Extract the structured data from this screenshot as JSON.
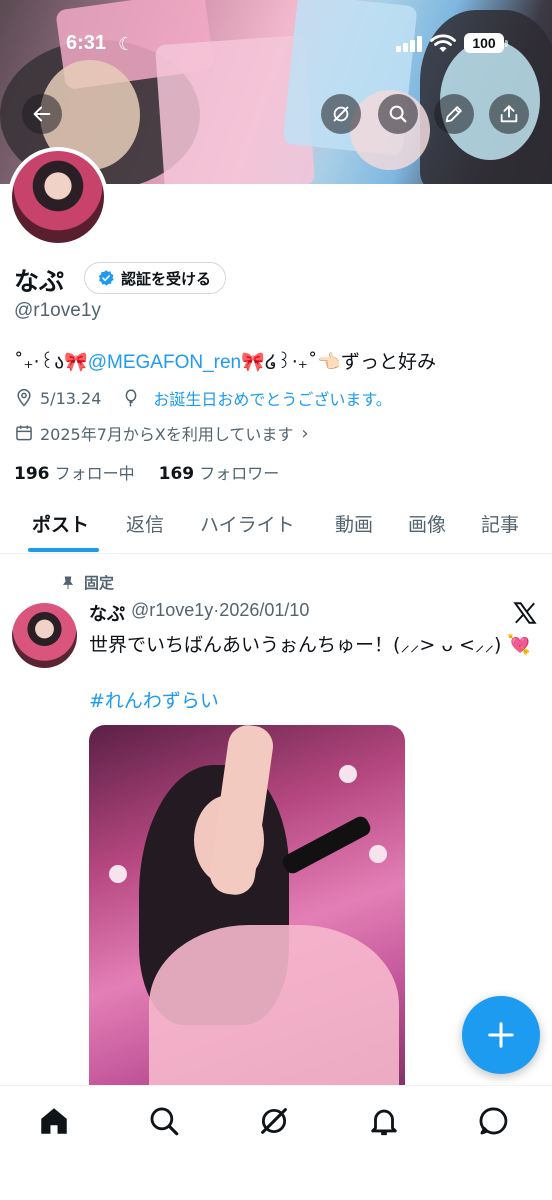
{
  "status_bar": {
    "time": "6:31",
    "battery": "100"
  },
  "profile": {
    "name": "なぷ",
    "verify_label": "認証を受ける",
    "handle": "@r1ove1y",
    "bio_prefix": "˚₊‧꒰ა🎀",
    "bio_mention": "@MEGAFON_ren",
    "bio_suffix": "🎀໒꒱‧₊˚👈🏻ずっと好み",
    "location": "5/13.24",
    "birthday_link": "お誕生日おめでとうございます。",
    "joined": "2025年7月からXを利用しています",
    "following_count": "196",
    "following_label": "フォロー中",
    "followers_count": "169",
    "followers_label": "フォロワー"
  },
  "tabs": [
    "ポスト",
    "返信",
    "ハイライト",
    "動画",
    "画像",
    "記事"
  ],
  "active_tab": "ポスト",
  "pinned_post": {
    "pinned_label": "固定",
    "author": "なぷ",
    "meta": "@r1ove1y·2026/01/10",
    "text": "世界でいちばんあいうぉんちゅー！(⸝⸝> ᴗ <⸝⸝) 💘",
    "hashtag": "#れんわずらい"
  },
  "icons": {
    "back": "back-arrow-icon",
    "grok": "grok-icon",
    "search": "search-icon",
    "edit": "pencil-icon",
    "share": "share-icon",
    "compose": "plus-icon",
    "nav": [
      "home-icon",
      "search-icon",
      "grok-icon",
      "bell-icon",
      "messages-icon"
    ]
  },
  "colors": {
    "accent": "#1d9bf0",
    "secondary_text": "#536471",
    "primary_text": "#0f1419"
  }
}
